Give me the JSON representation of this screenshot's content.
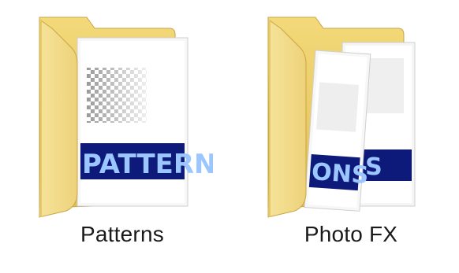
{
  "folders": [
    {
      "name": "Patterns",
      "icon": "folder-patterns-icon",
      "document_banner_text": "PATTERN"
    },
    {
      "name": "Photo FX",
      "icon": "folder-photofx-icon",
      "document_banner_text": [
        "ONS",
        "NS"
      ]
    }
  ],
  "colors": {
    "folder_front": "#f2dc8a",
    "folder_back": "#e8c75d",
    "banner_bg": "#0d1a7a",
    "banner_text": "#9cc6ff"
  }
}
